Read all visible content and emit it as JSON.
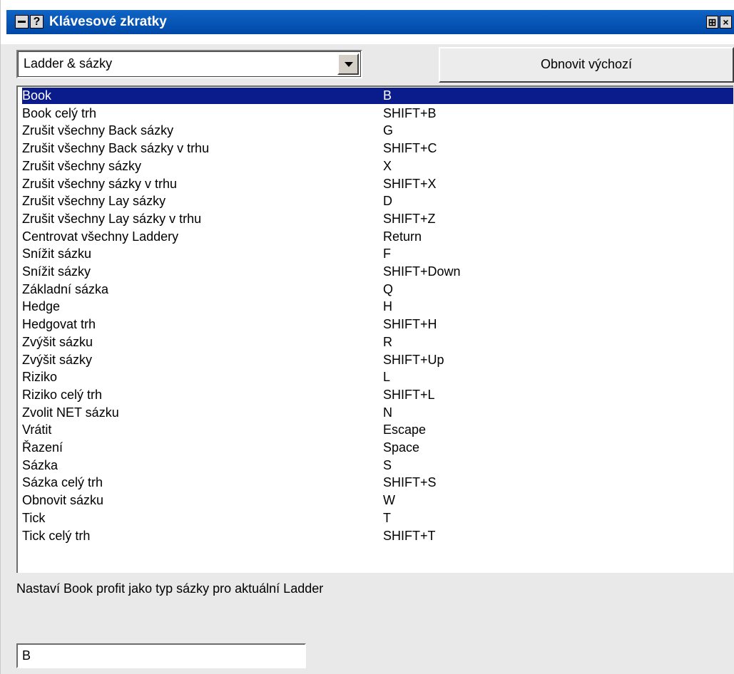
{
  "window": {
    "title": "Klávesové zkratky",
    "help_glyph": "?",
    "pin_glyph": "⊞",
    "close_glyph": "×"
  },
  "combo": {
    "selected": "Ladder & sázky"
  },
  "reset_button": {
    "label": "Obnovit výchozí"
  },
  "shortcuts": [
    {
      "action": "Book",
      "key": "B",
      "selected": true
    },
    {
      "action": "Book celý trh",
      "key": "SHIFT+B"
    },
    {
      "action": "Zrušit všechny Back sázky",
      "key": "G"
    },
    {
      "action": "Zrušit všechny Back sázky v trhu",
      "key": "SHIFT+C"
    },
    {
      "action": "Zrušit všechny sázky",
      "key": "X"
    },
    {
      "action": "Zrušit všechny sázky v trhu",
      "key": "SHIFT+X"
    },
    {
      "action": "Zrušit všechny Lay sázky",
      "key": "D"
    },
    {
      "action": "Zrušit všechny Lay sázky v trhu",
      "key": "SHIFT+Z"
    },
    {
      "action": "Centrovat všechny Laddery",
      "key": "Return"
    },
    {
      "action": "Snížit sázku",
      "key": "F"
    },
    {
      "action": "Snížit sázky",
      "key": "SHIFT+Down"
    },
    {
      "action": "Základní sázka",
      "key": "Q"
    },
    {
      "action": "Hedge",
      "key": "H"
    },
    {
      "action": "Hedgovat trh",
      "key": "SHIFT+H"
    },
    {
      "action": "Zvýšit sázku",
      "key": "R"
    },
    {
      "action": "Zvýšit sázky",
      "key": "SHIFT+Up"
    },
    {
      "action": "Riziko",
      "key": "L"
    },
    {
      "action": "Riziko celý trh",
      "key": "SHIFT+L"
    },
    {
      "action": "Zvolit NET sázku",
      "key": "N"
    },
    {
      "action": "Vrátit",
      "key": "Escape"
    },
    {
      "action": "Řazení",
      "key": "Space"
    },
    {
      "action": "Sázka",
      "key": "S"
    },
    {
      "action": "Sázka celý trh",
      "key": "SHIFT+S"
    },
    {
      "action": "Obnovit sázku",
      "key": "W"
    },
    {
      "action": "Tick",
      "key": "T"
    },
    {
      "action": "Tick celý trh",
      "key": "SHIFT+T"
    }
  ],
  "description": "Nastaví Book profit jako typ sázky pro aktuální Ladder",
  "shortcut_field": {
    "value": "B"
  },
  "colors": {
    "titlebar": "#0048a8",
    "selection": "#0a1c8c",
    "panel": "#e9e9ea"
  }
}
